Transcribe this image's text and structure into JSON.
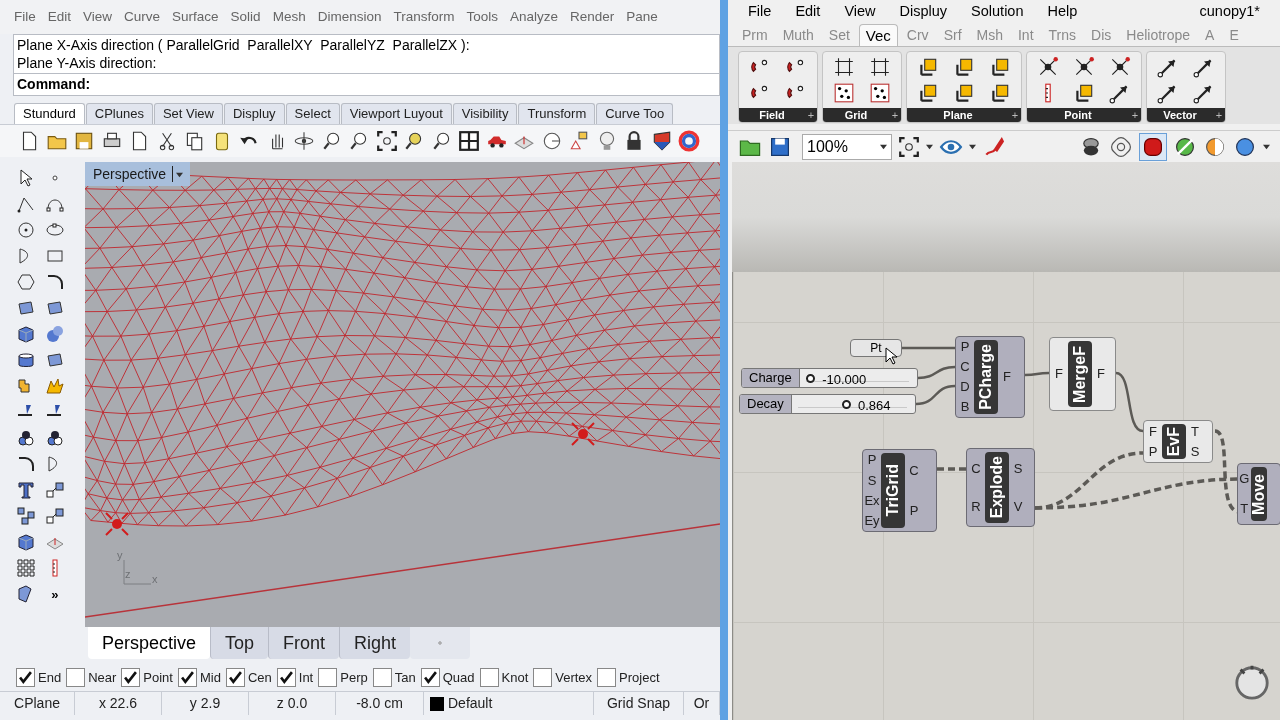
{
  "rhino": {
    "menu": [
      "File",
      "Edit",
      "View",
      "Curve",
      "Surface",
      "Solid",
      "Mesh",
      "Dimension",
      "Transform",
      "Tools",
      "Analyze",
      "Render",
      "Pane"
    ],
    "command_history": [
      "Plane X-Axis direction ( ParallelGrid  ParallelXY  ParallelYZ  ParallelZX ):",
      "Plane Y-Axis direction:"
    ],
    "command_prompt": "Command:",
    "toolbar_tabs": [
      {
        "label": "Stundurd",
        "selected": true
      },
      {
        "label": "CPlunes",
        "selected": false
      },
      {
        "label": "Set View",
        "selected": false
      },
      {
        "label": "Displuy",
        "selected": false
      },
      {
        "label": "Select",
        "selected": false
      },
      {
        "label": "Viewport Luyout",
        "selected": false
      },
      {
        "label": "Visibility",
        "selected": false
      },
      {
        "label": "Trunsform",
        "selected": false
      },
      {
        "label": "Curve Too",
        "selected": false
      }
    ],
    "more_tools": "»",
    "viewport": {
      "title": "Perspective",
      "axis_labels": [
        "y",
        "z",
        "x"
      ]
    },
    "viewport_tabs": [
      {
        "label": "Perspective",
        "selected": true
      },
      {
        "label": "Top",
        "selected": false
      },
      {
        "label": "Front",
        "selected": false
      },
      {
        "label": "Right",
        "selected": false
      }
    ],
    "osnaps": [
      {
        "label": "End",
        "checked": true
      },
      {
        "label": "Near",
        "checked": false
      },
      {
        "label": "Point",
        "checked": true
      },
      {
        "label": "Mid",
        "checked": true
      },
      {
        "label": "Cen",
        "checked": true
      },
      {
        "label": "Int",
        "checked": true
      },
      {
        "label": "Perp",
        "checked": false
      },
      {
        "label": "Tan",
        "checked": false
      },
      {
        "label": "Quad",
        "checked": true
      },
      {
        "label": "Knot",
        "checked": false
      },
      {
        "label": "Vertex",
        "checked": false
      },
      {
        "label": "Project",
        "checked": false
      }
    ],
    "status_bar": [
      {
        "kind": "text",
        "text": "CPlane"
      },
      {
        "kind": "text",
        "text": "x 22.6"
      },
      {
        "kind": "text",
        "text": "y 2.9"
      },
      {
        "kind": "text",
        "text": "z 0.0"
      },
      {
        "kind": "text",
        "text": "-8.0 cm"
      },
      {
        "kind": "layer",
        "text": "Default"
      },
      {
        "kind": "text",
        "text": "Grid Snap"
      },
      {
        "kind": "text",
        "text": "Or"
      }
    ]
  },
  "grasshopper": {
    "menu": [
      "File",
      "Edit",
      "View",
      "Displuy",
      "Solution",
      "Help"
    ],
    "document_title": "cunopy1*",
    "tabs": [
      {
        "label": "Prm",
        "selected": false
      },
      {
        "label": "Muth",
        "selected": false
      },
      {
        "label": "Set",
        "selected": false
      },
      {
        "label": "Vec",
        "selected": true
      },
      {
        "label": "Crv",
        "selected": false
      },
      {
        "label": "Srf",
        "selected": false
      },
      {
        "label": "Msh",
        "selected": false
      },
      {
        "label": "Int",
        "selected": false
      },
      {
        "label": "Trns",
        "selected": false
      },
      {
        "label": "Dis",
        "selected": false
      },
      {
        "label": "Heliotrope",
        "selected": false
      },
      {
        "label": "A",
        "selected": false
      },
      {
        "label": "E",
        "selected": false
      }
    ],
    "panels": [
      {
        "label": "Field",
        "expand": "+"
      },
      {
        "label": "Grid",
        "expand": "+"
      },
      {
        "label": "Plane",
        "expand": "+"
      },
      {
        "label": "Point",
        "expand": "+"
      },
      {
        "label": "Vector",
        "expand": "+"
      }
    ],
    "zoom": "100%",
    "nodes": [
      {
        "kind": "param",
        "name": "Pt"
      },
      {
        "kind": "slider",
        "label": "Charge",
        "value": "-10.000",
        "level": 0.09
      },
      {
        "kind": "slider",
        "label": "Decay",
        "value": "0.864",
        "level": 0.44
      },
      {
        "kind": "component",
        "name": "PCharge",
        "preview": true,
        "inputs": [
          "P",
          "C",
          "D",
          "B"
        ],
        "outputs": [
          "F"
        ]
      },
      {
        "kind": "component",
        "name": "MergeF",
        "preview": false,
        "inputs": [
          "F"
        ],
        "outputs": [
          "F"
        ]
      },
      {
        "kind": "component",
        "name": "EvF",
        "preview": false,
        "inputs": [
          "F",
          "P"
        ],
        "outputs": [
          "T",
          "S"
        ]
      },
      {
        "kind": "component",
        "name": "TriGrid",
        "preview": true,
        "inputs": [
          "P",
          "S",
          "Ex",
          "Ey"
        ],
        "outputs": [
          "C",
          "P"
        ]
      },
      {
        "kind": "component",
        "name": "Explode",
        "preview": true,
        "inputs": [
          "C",
          "R"
        ],
        "outputs": [
          "S",
          "V"
        ]
      },
      {
        "kind": "component",
        "name": "Move",
        "preview": true,
        "inputs": [
          "G",
          "T"
        ]
      }
    ]
  }
}
